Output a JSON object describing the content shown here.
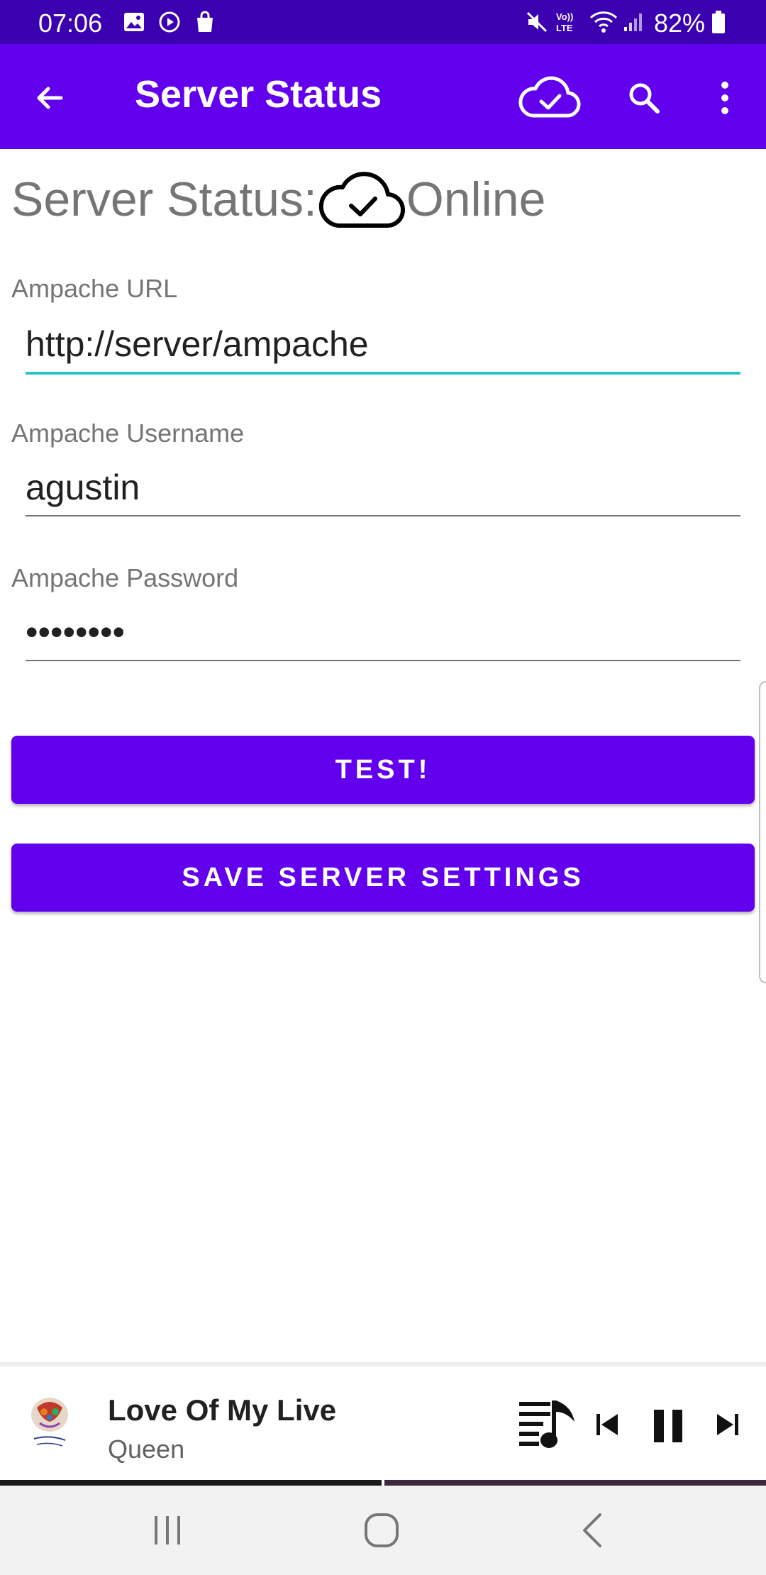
{
  "status_bar": {
    "time": "07:06",
    "battery": "82%",
    "icons": [
      "gallery-icon",
      "play-circle-icon",
      "shopping-bag-icon",
      "mute-icon",
      "volte-icon",
      "wifi-icon",
      "signal-icon",
      "battery-icon"
    ],
    "colors": {
      "background": "#3b00b0"
    }
  },
  "app_bar": {
    "title": "Server Status",
    "icons": [
      "back-arrow-icon",
      "cloud-check-icon",
      "search-icon",
      "more-vert-icon"
    ],
    "colors": {
      "background": "#6200ee"
    }
  },
  "server_status": {
    "label": "Server Status:",
    "value": "Online",
    "icon": "cloud-check-icon"
  },
  "form": {
    "url": {
      "label": "Ampache URL",
      "value": "http://server/ampache"
    },
    "username": {
      "label": "Ampache Username",
      "value": "agustin"
    },
    "password": {
      "label": "Ampache Password",
      "value": "ampache1"
    },
    "focus_color": "#26c6c0"
  },
  "buttons": {
    "test": "TEST!",
    "save": "SAVE SERVER SETTINGS",
    "color": "#6200ee"
  },
  "now_playing": {
    "title": "Love Of My Live",
    "artist": "Queen",
    "icons": [
      "queue-music-icon",
      "skip-previous-icon",
      "pause-icon",
      "skip-next-icon"
    ]
  },
  "nav_bar": {
    "icons": [
      "recent-apps-icon",
      "home-icon",
      "back-icon"
    ]
  }
}
